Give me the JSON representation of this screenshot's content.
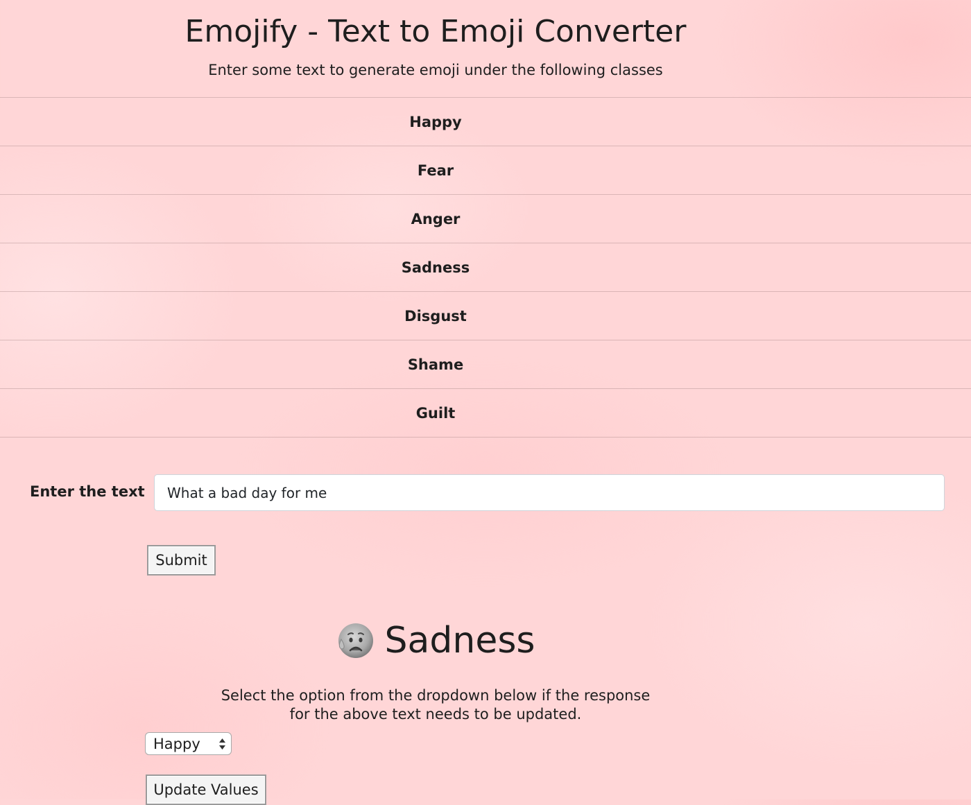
{
  "header": {
    "title": "Emojify - Text to Emoji Converter",
    "subtitle": "Enter some text to generate emoji under the following classes"
  },
  "classes": [
    "Happy",
    "Fear",
    "Anger",
    "Sadness",
    "Disgust",
    "Shame",
    "Guilt"
  ],
  "form": {
    "text_label": "Enter the text",
    "text_value": "What a bad day for me",
    "submit_label": "Submit"
  },
  "result": {
    "emoji_icon": "sad-sweat-emoji-icon",
    "label": "Sadness"
  },
  "update": {
    "instruction_line1": "Select the option from the dropdown below if the response",
    "instruction_line2": "for the above text needs to be updated.",
    "selected_option": "Happy",
    "button_label": "Update Values"
  },
  "colors": {
    "background": "#ffd6d7",
    "text": "#1e1e1e",
    "input_background": "#ffffff"
  }
}
